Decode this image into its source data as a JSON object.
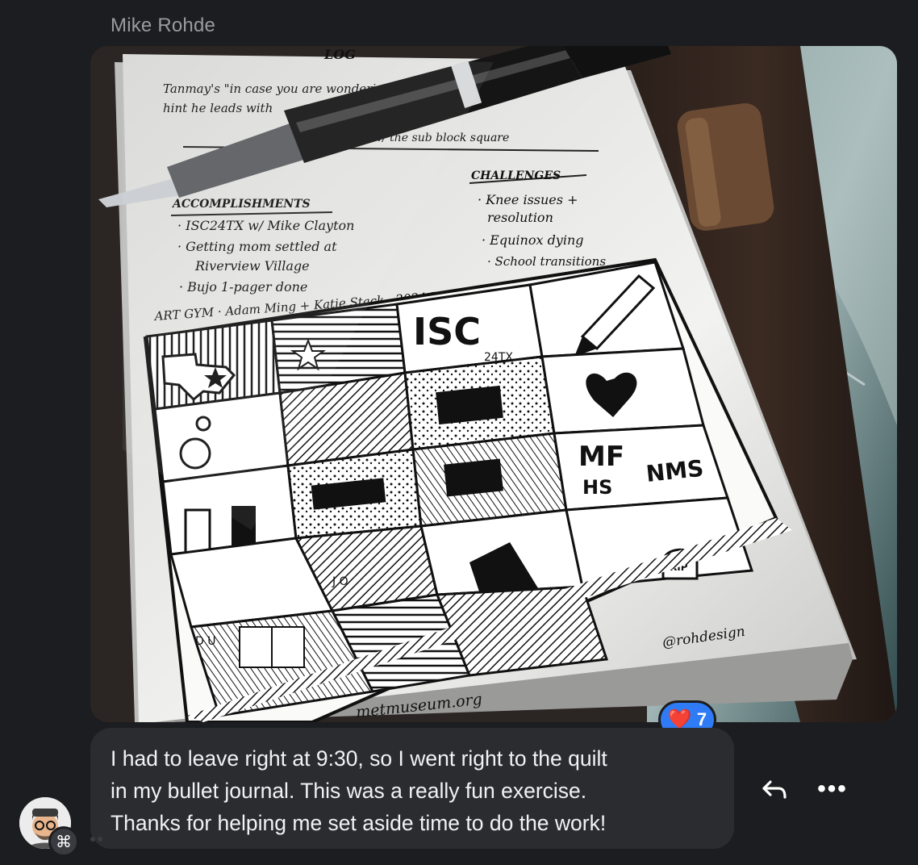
{
  "message": {
    "sender_name": "Mike Rohde",
    "text_lines": [
      "I had to leave right at 9:30, so I went right to the quilt",
      "in my bullet journal. This was a really fun exercise.",
      "Thanks for helping me set aside time to do the work!"
    ],
    "reaction": {
      "emoji": "❤️",
      "count": "7"
    }
  },
  "photo": {
    "sketch_texts": {
      "log": "LOG",
      "line1": "Tanmay's \"in case you are wondering\"",
      "line2": "hint he leads with",
      "line3": "w/ the sub block square",
      "accomplishments_heading": "ACCOMPLISHMENTS",
      "acc1": "· ISC24TX w/ Mike Clayton",
      "acc2": "· Getting mom settled at",
      "acc3": "Riverview Village",
      "acc4": "· Bujo 1-pager done",
      "challenges_heading": "CHALLENGES",
      "ch1": "· Knee issues +",
      "ch2": "resolution",
      "ch3": "· Equinox dying",
      "ch4": "· School transitions",
      "artgym": "ART GYM · Adam Ming + Katie Stack · 2024 Reflection Quilt",
      "isc_big": "ISC",
      "isc_small": "24TX",
      "mf": "MF",
      "hs": "HS",
      "nms": "NMS",
      "rip": "RIP",
      "jo": "J O",
      "du": "D U",
      "handle": "@rohdesign",
      "url": "metmuseum.org"
    }
  },
  "actions": {
    "reply_icon": "reply-arrow-icon",
    "more_icon": "more-dots-icon",
    "more_glyph": "•••"
  },
  "colors": {
    "background": "#1c1d20",
    "bubble": "#2b2c30",
    "reaction_badge": "#2f7bf6",
    "sender_name": "#9a9ba0"
  }
}
